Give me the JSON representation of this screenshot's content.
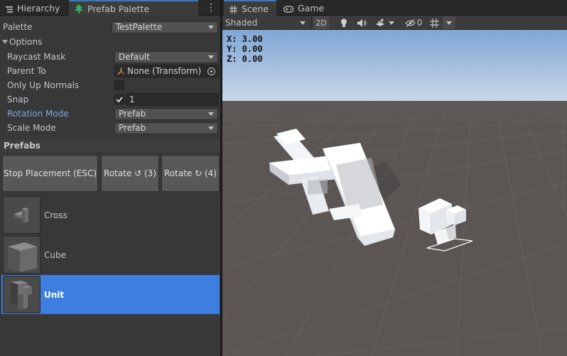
{
  "left_panel": {
    "tabs": [
      {
        "label": "Hierarchy",
        "icon": "hierarchy-icon"
      },
      {
        "label": "Prefab Palette",
        "icon": "tree-icon",
        "active": true
      }
    ],
    "palette": {
      "label": "Palette",
      "value": "TestPalette"
    },
    "options_header": "Options",
    "fields": {
      "raycast_mask": {
        "label": "Raycast Mask",
        "value": "Default"
      },
      "parent_to": {
        "label": "Parent To",
        "value": "None (Transform)"
      },
      "only_up_normals": {
        "label": "Only Up Normals",
        "checked": false
      },
      "snap": {
        "label": "Snap",
        "checked": true,
        "value": "1"
      },
      "rotation_mode": {
        "label": "Rotation Mode",
        "value": "Prefab"
      },
      "scale_mode": {
        "label": "Scale Mode",
        "value": "Prefab"
      }
    },
    "prefabs_header": "Prefabs",
    "buttons": {
      "stop": "Stop Placement (ESC)",
      "rotate_ccw": "Rotate ↺ (3)",
      "rotate_cw": "Rotate ↻ (4)"
    },
    "prefabs": [
      {
        "name": "Cross",
        "selected": false
      },
      {
        "name": "Cube",
        "selected": false
      },
      {
        "name": "Unit",
        "selected": true
      }
    ]
  },
  "right_panel": {
    "tabs": [
      {
        "label": "Scene",
        "icon": "grid-icon",
        "active": true
      },
      {
        "label": "Game",
        "icon": "gamepad-icon",
        "active": false
      }
    ],
    "toolbar": {
      "shading": "Shaded",
      "mode_2d": "2D",
      "hidden_count": "0"
    },
    "coords": {
      "x": "X: 3.00",
      "y": "Y: 0.00",
      "z": "Z: 0.00"
    }
  },
  "colors": {
    "accent_blue": "#3d7ee0",
    "label_blue": "#7ba7e1",
    "panel_bg": "#383838",
    "sky_top": "#9fbde0",
    "ground": "#5b5654"
  }
}
